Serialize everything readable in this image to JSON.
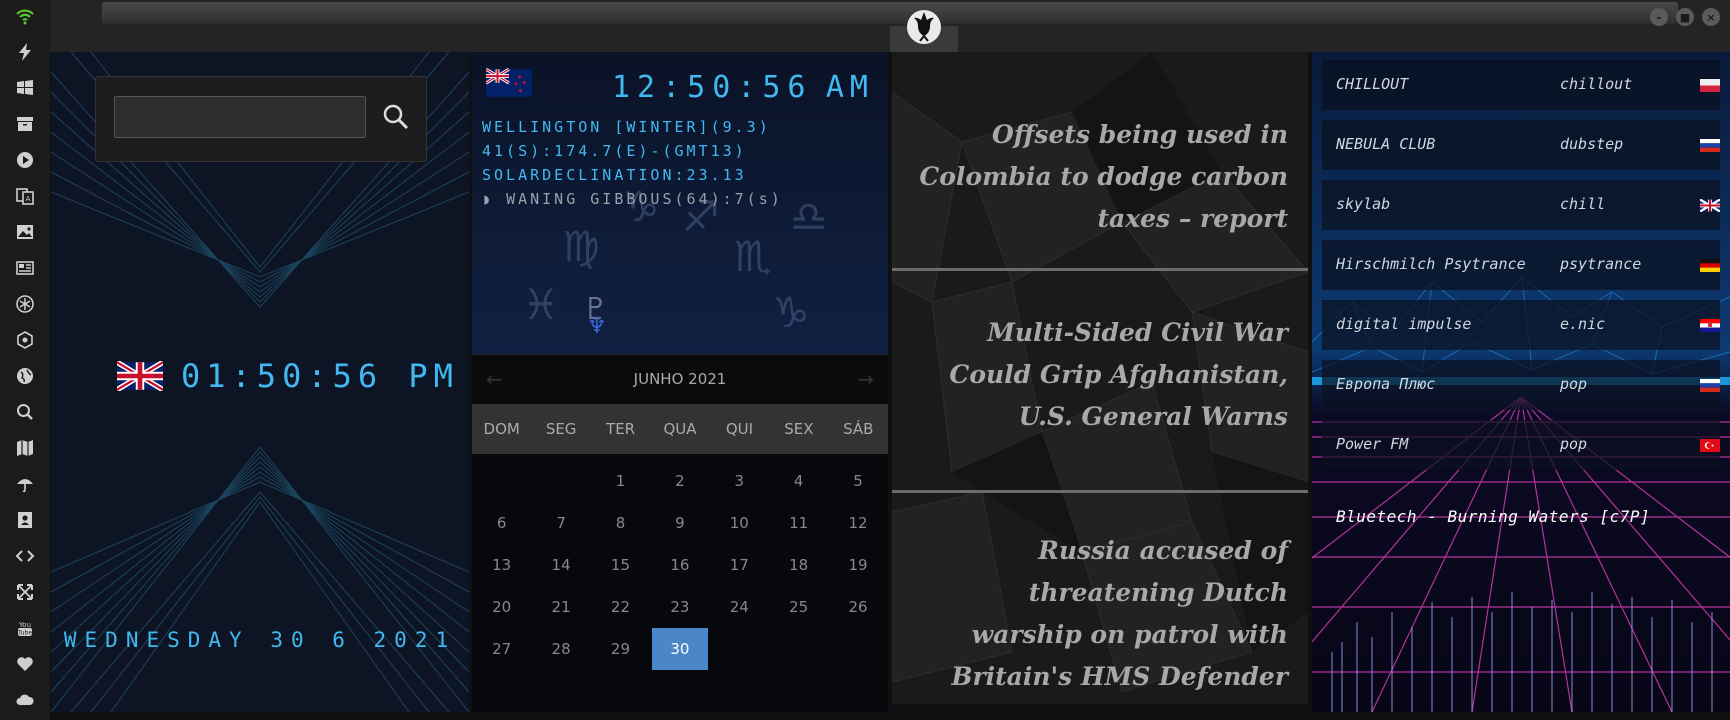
{
  "colors": {
    "accent_blue": "#41b8f0",
    "today_bg": "#4a86c8",
    "sidebar_bg": "#1b1b1b",
    "news_text": "#a8a8a8"
  },
  "sidebar": {
    "items": [
      {
        "icon": "wifi-icon"
      },
      {
        "icon": "lightning-icon"
      },
      {
        "icon": "windows-icon"
      },
      {
        "icon": "archive-icon"
      },
      {
        "icon": "play-icon"
      },
      {
        "icon": "translate-icon"
      },
      {
        "icon": "image-icon"
      },
      {
        "icon": "news-icon"
      },
      {
        "icon": "snowflake-icon"
      },
      {
        "icon": "hexagon-icon"
      },
      {
        "icon": "globe-icon"
      },
      {
        "icon": "search-icon"
      },
      {
        "icon": "map-icon"
      },
      {
        "icon": "umbrella-icon"
      },
      {
        "icon": "contacts-icon"
      },
      {
        "icon": "code-icon"
      },
      {
        "icon": "expand-icon"
      },
      {
        "icon": "youtube-icon"
      },
      {
        "icon": "heart-icon"
      },
      {
        "icon": "cloud-icon"
      }
    ]
  },
  "window": {
    "minimize": "–",
    "maximize": "■",
    "close": "×",
    "logo_icon": "rebel-alliance-icon"
  },
  "world_clock": {
    "search_value": "",
    "uk_flag_icon": "uk-flag-icon",
    "uk_time": "01:50:56 PM",
    "date": "WEDNESDAY 30 6 2021"
  },
  "astro": {
    "nz_flag_icon": "nz-flag-icon",
    "time": "12:50:56",
    "ampm": "AM",
    "location": "WELLINGTON [WINTER](9.3)",
    "coords": "41(S):174.7(E)-(GMT13)",
    "declination": "SOLARDECLINATION:23.13",
    "moon": "WANING GIBBOUS(64):7(s)"
  },
  "calendar": {
    "title": "JUNHO 2021",
    "prev": "←",
    "next": "→",
    "weekdays": [
      "DOM",
      "SEG",
      "TER",
      "QUA",
      "QUI",
      "SEX",
      "SÁB"
    ],
    "days": [
      [
        "",
        "",
        "1",
        "2",
        "3",
        "4",
        "5"
      ],
      [
        "6",
        "7",
        "8",
        "9",
        "10",
        "11",
        "12"
      ],
      [
        "13",
        "14",
        "15",
        "16",
        "17",
        "18",
        "19"
      ],
      [
        "20",
        "21",
        "22",
        "23",
        "24",
        "25",
        "26"
      ],
      [
        "27",
        "28",
        "29",
        "30",
        "",
        "",
        ""
      ]
    ],
    "today": "30"
  },
  "news": {
    "items": [
      "Offsets being used in Colombia to dodge carbon taxes – report",
      "Multi-Sided Civil War Could Grip Afghanistan, U.S. General Warns",
      "Russia accused of threatening Dutch warship on patrol with Britain's HMS Defender"
    ]
  },
  "radio": {
    "stations": [
      {
        "name": "CHILLOUT",
        "genre": "chillout",
        "flag": "poland-flag-icon"
      },
      {
        "name": "NEBULA CLUB",
        "genre": "dubstep",
        "flag": "russia-flag-icon"
      },
      {
        "name": "skylab",
        "genre": "chill",
        "flag": "uk-flag-icon"
      },
      {
        "name": "Hirschmilch Psytrance",
        "genre": "psytrance",
        "flag": "germany-flag-icon"
      },
      {
        "name": "digital impulse",
        "genre": "e.nic",
        "flag": "croatia-flag-icon"
      },
      {
        "name": "Европа Плюс",
        "genre": "pop",
        "flag": "russia-flag-icon"
      },
      {
        "name": "Power FM",
        "genre": "pop",
        "flag": "turkey-flag-icon"
      }
    ],
    "now_playing": "Bluetech - Burning Waters [c7P]"
  }
}
